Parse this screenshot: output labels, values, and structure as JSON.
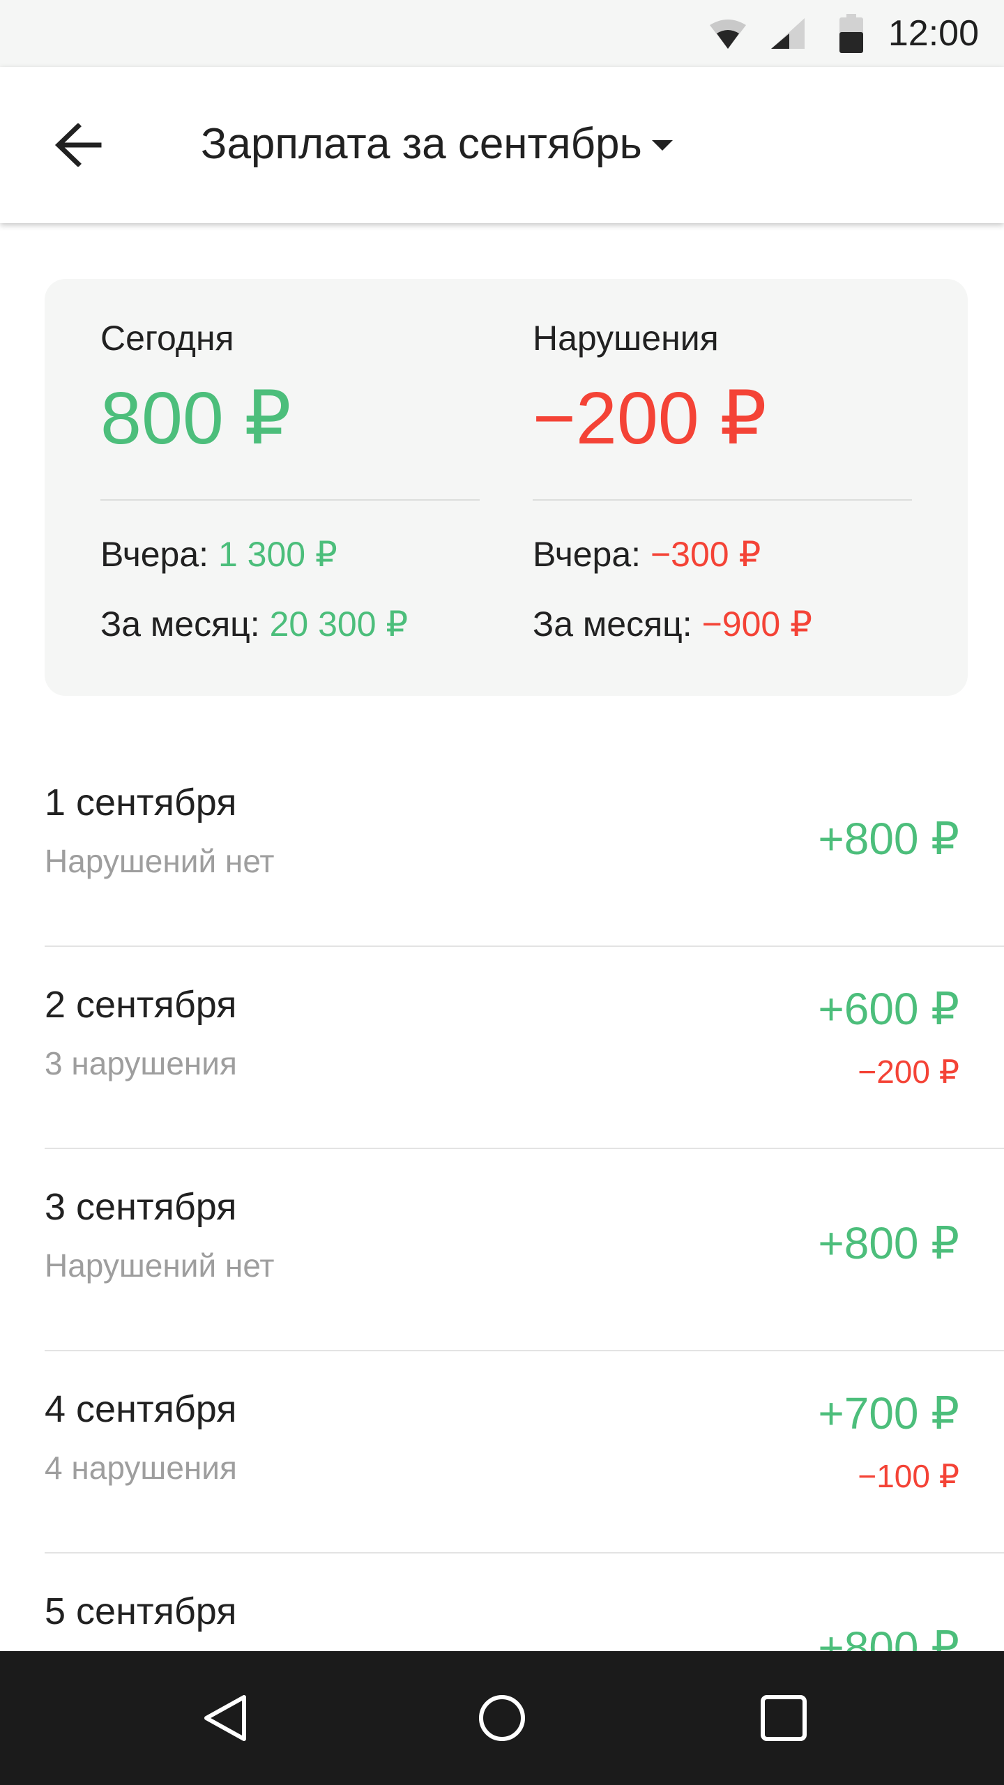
{
  "status_bar": {
    "time": "12:00",
    "icons": [
      "wifi-icon",
      "cell-signal-icon",
      "battery-icon"
    ]
  },
  "app_bar": {
    "back_icon": "arrow-left-icon",
    "title": "Зарплата за сентябрь",
    "dropdown_icon": "caret-down-icon"
  },
  "summary": {
    "today": {
      "label": "Сегодня",
      "value": "800 ₽",
      "yesterday_label": "Вчера:",
      "yesterday_value": "1 300 ₽",
      "month_label": "За месяц:",
      "month_value": "20 300 ₽"
    },
    "violations": {
      "label": "Нарушения",
      "value": "−200 ₽",
      "yesterday_label": "Вчера:",
      "yesterday_value": "−300 ₽",
      "month_label": "За месяц:",
      "month_value": "−900 ₽"
    }
  },
  "days": [
    {
      "date": "1 сентября",
      "status": "Нарушений нет",
      "amount": "+800 ₽",
      "penalty": ""
    },
    {
      "date": "2 сентября",
      "status": "3 нарушения",
      "amount": "+600 ₽",
      "penalty": "−200 ₽"
    },
    {
      "date": "3 сентября",
      "status": "Нарушений нет",
      "amount": "+800 ₽",
      "penalty": ""
    },
    {
      "date": "4 сентября",
      "status": "4 нарушения",
      "amount": "+700 ₽",
      "penalty": "−100 ₽"
    },
    {
      "date": "5 сентября",
      "status": "",
      "amount": "+800 ₽",
      "penalty": ""
    }
  ],
  "colors": {
    "positive": "#4cbe7b",
    "negative": "#f44336",
    "card_bg": "#f5f6f5",
    "nav_bar": "#1b1b1b"
  },
  "nav_bar": {
    "icons": [
      "nav-back-icon",
      "nav-home-icon",
      "nav-recents-icon"
    ]
  }
}
